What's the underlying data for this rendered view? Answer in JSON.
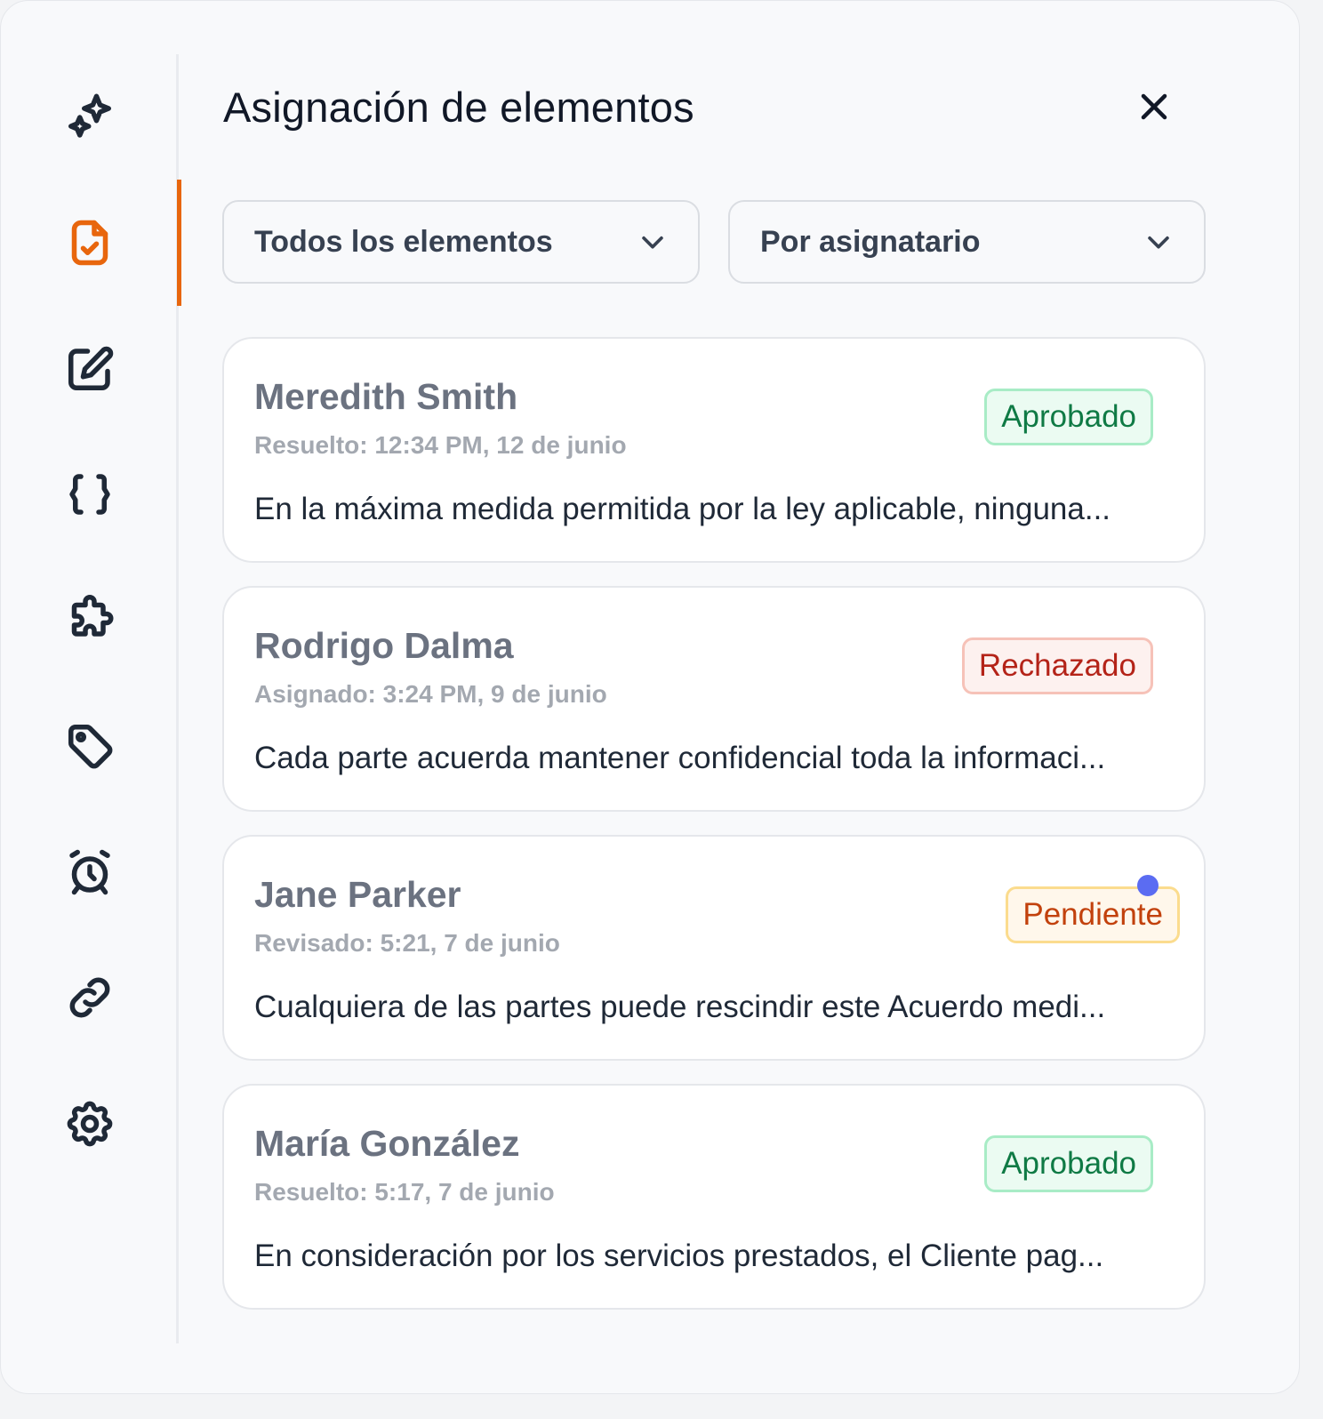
{
  "header": {
    "title": "Asignación de elementos",
    "close_icon": "close-icon"
  },
  "sidebar": {
    "items": [
      {
        "name": "sparkles",
        "icon": "sparkles-icon",
        "active": false
      },
      {
        "name": "document-check",
        "icon": "document-check-icon",
        "active": true
      },
      {
        "name": "edit",
        "icon": "edit-icon",
        "active": false
      },
      {
        "name": "variables",
        "icon": "braces-icon",
        "active": false
      },
      {
        "name": "integrations",
        "icon": "puzzle-icon",
        "active": false
      },
      {
        "name": "tags",
        "icon": "tag-icon",
        "active": false
      },
      {
        "name": "reminders",
        "icon": "alarm-icon",
        "active": false
      },
      {
        "name": "links",
        "icon": "link-icon",
        "active": false
      },
      {
        "name": "settings",
        "icon": "gear-icon",
        "active": false
      }
    ],
    "accent": "#e8660d"
  },
  "filters": {
    "items_filter": "Todos los elementos",
    "group_filter": "Por asignatario"
  },
  "cards": [
    {
      "name": "Meredith Smith",
      "time": "Resuelto: 12:34 PM, 12 de junio",
      "status": "Aprobado",
      "excerpt": "En la máxima medida permitida por la ley aplicable, ninguna..."
    },
    {
      "name": "Rodrigo Dalma",
      "time": "Asignado: 3:24 PM, 9 de junio",
      "status": "Rechazado",
      "excerpt": "Cada parte acuerda mantener confidencial toda la informaci..."
    },
    {
      "name": "Jane Parker",
      "time": "Revisado: 5:21, 7 de junio",
      "status": "Pendiente",
      "excerpt": "Cualquiera de las partes puede rescindir este Acuerdo medi..."
    },
    {
      "name": "María González",
      "time": "Resuelto: 5:17, 7 de junio",
      "status": "Aprobado",
      "excerpt": "En consideración por los servicios prestados, el Cliente pag..."
    }
  ],
  "colors": {
    "approved": "#0f7a45",
    "rejected": "#b42318",
    "pending": "#c2410c",
    "unread_dot": "#5b6cf2"
  }
}
